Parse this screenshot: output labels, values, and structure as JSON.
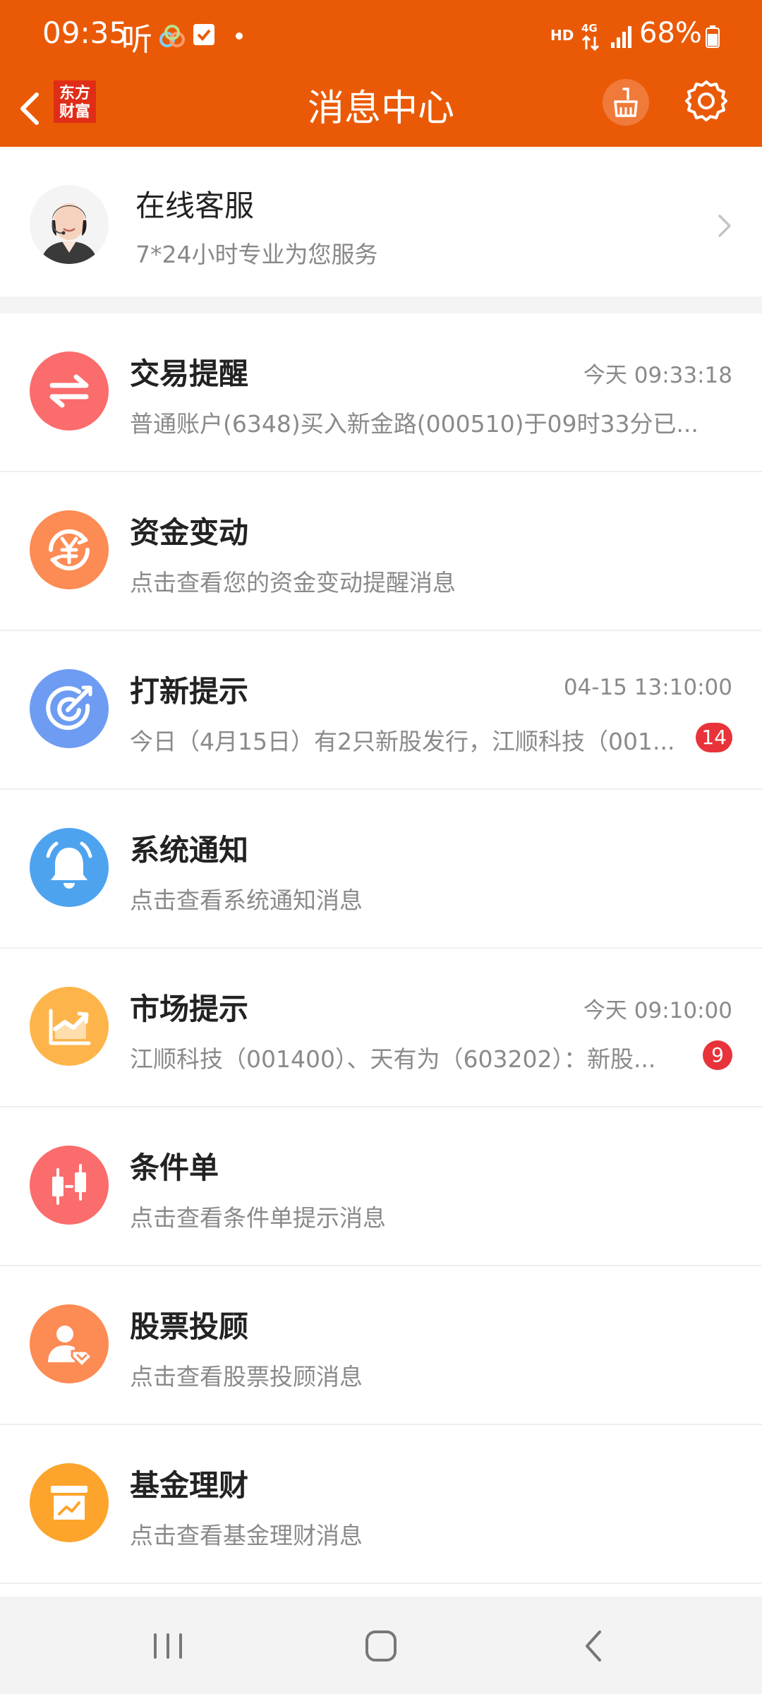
{
  "status_bar": {
    "time": "09:35",
    "ting": "听",
    "hd": "HD",
    "network": "4G",
    "battery": "68%"
  },
  "header": {
    "logo_line1": "东方",
    "logo_line2": "财富",
    "title": "消息中心"
  },
  "customer_service": {
    "title": "在线客服",
    "subtitle": "7*24小时专业为您服务"
  },
  "messages": [
    {
      "title": "交易提醒",
      "time": "今天 09:33:18",
      "subtitle": "普通账户(6348)买入新金路(000510)于09时33分已...",
      "icon": "exchange-icon",
      "color": "#fb6c6c"
    },
    {
      "title": "资金变动",
      "subtitle": "点击查看您的资金变动提醒消息",
      "icon": "yuan-icon",
      "color": "#fd8b54"
    },
    {
      "title": "打新提示",
      "time": "04-15 13:10:00",
      "subtitle": "今日（4月15日）有2只新股发行，江顺科技（001...",
      "badge": "14",
      "icon": "target-icon",
      "color": "#6d9cf2"
    },
    {
      "title": "系统通知",
      "subtitle": "点击查看系统通知消息",
      "icon": "bell-icon",
      "color": "#4ea3ef"
    },
    {
      "title": "市场提示",
      "time": "今天 09:10:00",
      "subtitle": "江顺科技（001400）、天有为（603202）：新股...",
      "badge": "9",
      "icon": "trend-icon",
      "color": "#fdb54b"
    },
    {
      "title": "条件单",
      "subtitle": "点击查看条件单提示消息",
      "icon": "candlestick-icon",
      "color": "#fb6c6c"
    },
    {
      "title": "股票投顾",
      "subtitle": "点击查看股票投顾消息",
      "icon": "advisor-icon",
      "color": "#fd8b54"
    },
    {
      "title": "基金理财",
      "subtitle": "点击查看基金理财消息",
      "icon": "fund-icon",
      "color": "#fda42c"
    }
  ]
}
